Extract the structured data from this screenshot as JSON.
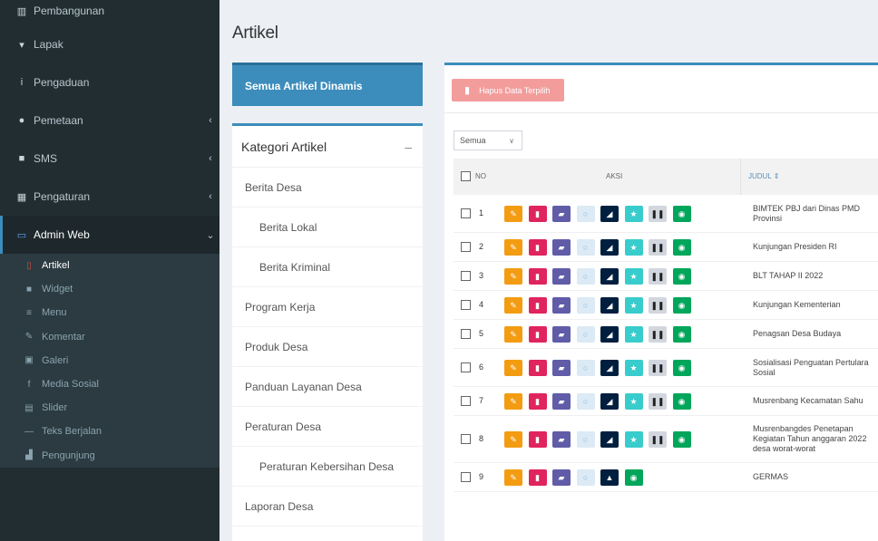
{
  "sidebar": {
    "items": [
      {
        "icon": "bank-icon",
        "glyph": "▥",
        "label": "Pembangunan",
        "chevron": ""
      },
      {
        "icon": "cart-icon",
        "glyph": "▾",
        "label": "Lapak",
        "chevron": ""
      },
      {
        "icon": "info-icon",
        "glyph": "i",
        "label": "Pengaduan",
        "chevron": ""
      },
      {
        "icon": "map-marker-icon",
        "glyph": "●",
        "label": "Pemetaan",
        "chevron": "‹"
      },
      {
        "icon": "envelope-icon",
        "glyph": "■",
        "label": "SMS",
        "chevron": "‹"
      },
      {
        "icon": "users-icon",
        "glyph": "▦",
        "label": "Pengaturan",
        "chevron": "‹"
      },
      {
        "icon": "desktop-icon",
        "glyph": "▭",
        "label": "Admin Web",
        "chevron": "⌄"
      }
    ],
    "submenu": [
      {
        "icon": "file-icon",
        "glyph": "▯",
        "label": "Artikel"
      },
      {
        "icon": "widget-icon",
        "glyph": "■",
        "label": "Widget"
      },
      {
        "icon": "bars-icon",
        "glyph": "≡",
        "label": "Menu"
      },
      {
        "icon": "comments-icon",
        "glyph": "✎",
        "label": "Komentar"
      },
      {
        "icon": "image-icon",
        "glyph": "▣",
        "label": "Galeri"
      },
      {
        "icon": "facebook-icon",
        "glyph": "f",
        "label": "Media Sosial"
      },
      {
        "icon": "slider-icon",
        "glyph": "▤",
        "label": "Slider"
      },
      {
        "icon": "minus-icon",
        "glyph": "—",
        "label": "Teks Berjalan"
      },
      {
        "icon": "chart-icon",
        "glyph": "▟",
        "label": "Pengunjung"
      }
    ]
  },
  "page": {
    "title": "Artikel"
  },
  "left": {
    "all_button": "Semua Artikel Dinamis",
    "category_title": "Kategori Artikel",
    "category_toggle": "–",
    "categories": [
      {
        "label": "Berita Desa",
        "sub": false
      },
      {
        "label": "Berita Lokal",
        "sub": true
      },
      {
        "label": "Berita Kriminal",
        "sub": true
      },
      {
        "label": "Program Kerja",
        "sub": false
      },
      {
        "label": "Produk Desa",
        "sub": false
      },
      {
        "label": "Panduan Layanan Desa",
        "sub": false
      },
      {
        "label": "Peraturan Desa",
        "sub": false
      },
      {
        "label": "Peraturan Kebersihan Desa",
        "sub": true
      },
      {
        "label": "Laporan Desa",
        "sub": false
      }
    ]
  },
  "main": {
    "hapus_button": "Hapus Data Terpilih",
    "filter": {
      "value": "Semua",
      "caret": "∨"
    },
    "table": {
      "col_no": "NO",
      "col_aksi": "AKSI",
      "col_judul": "JUDUL ⇕",
      "rows": [
        {
          "no": "1",
          "lines": [
            "BIMTEK PBJ dari Dinas PMD",
            "Provinsi"
          ]
        },
        {
          "no": "2",
          "lines": [
            "Kunjungan Presiden RI"
          ]
        },
        {
          "no": "3",
          "lines": [
            "BLT TAHAP II 2022"
          ]
        },
        {
          "no": "4",
          "lines": [
            "Kunjungan Kementerian"
          ]
        },
        {
          "no": "5",
          "lines": [
            "Penagsan Desa Budaya"
          ]
        },
        {
          "no": "6",
          "lines": [
            "Sosialisasi Penguatan Pertulara",
            "Sosial"
          ]
        },
        {
          "no": "7",
          "lines": [
            "Musrenbang Kecamatan Sahu"
          ]
        },
        {
          "no": "8",
          "lines": [
            "Musrenbangdes Penetapan",
            "Kegiatan Tahun anggaran 2022",
            "desa worat-worat"
          ]
        },
        {
          "no": "9",
          "lines": [
            "GERMAS"
          ]
        }
      ]
    },
    "action_icons": [
      {
        "name": "edit-icon",
        "glyph": "✎",
        "cls": "b-orange"
      },
      {
        "name": "trash-icon",
        "glyph": "▮",
        "cls": "b-pink"
      },
      {
        "name": "folder-icon",
        "glyph": "▰",
        "cls": "b-purple"
      },
      {
        "name": "comment-icon",
        "glyph": "○",
        "cls": "b-light"
      },
      {
        "name": "unlock-icon",
        "glyph": "◢",
        "cls": "b-navy"
      },
      {
        "name": "star-icon",
        "glyph": "★",
        "cls": "b-teal"
      },
      {
        "name": "pause-icon",
        "glyph": "❚❚",
        "cls": "b-gray"
      },
      {
        "name": "eye-icon",
        "glyph": "◉",
        "cls": "b-green"
      }
    ],
    "last_row_icons": [
      {
        "name": "edit-icon",
        "glyph": "✎",
        "cls": "b-orange"
      },
      {
        "name": "trash-icon",
        "glyph": "▮",
        "cls": "b-pink"
      },
      {
        "name": "folder-icon",
        "glyph": "▰",
        "cls": "b-purple"
      },
      {
        "name": "comment-icon",
        "glyph": "○",
        "cls": "b-light"
      },
      {
        "name": "lock-icon",
        "glyph": "▲",
        "cls": "b-navy"
      },
      {
        "name": "eye-icon",
        "glyph": "◉",
        "cls": "b-green"
      }
    ]
  }
}
